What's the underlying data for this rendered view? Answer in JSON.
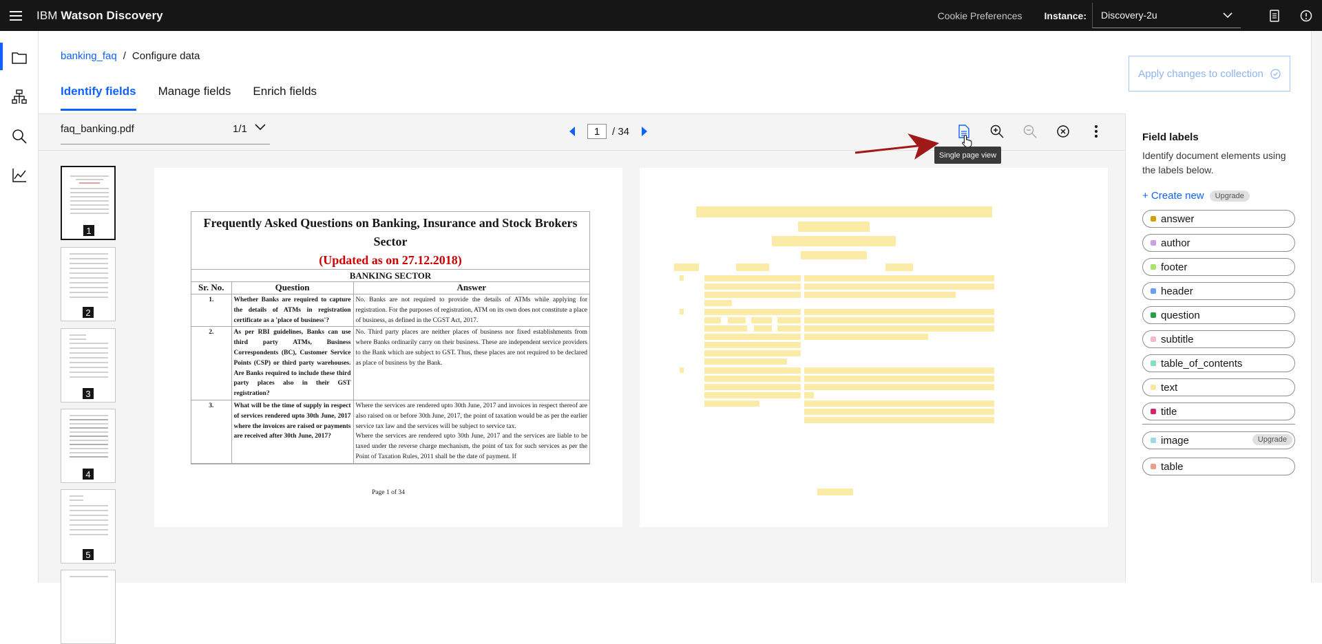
{
  "topbar": {
    "brand_prefix": "IBM",
    "brand_name": "Watson Discovery",
    "cookie": "Cookie Preferences",
    "instance_label": "Instance:",
    "instance_value": "Discovery-2u"
  },
  "breadcrumb": {
    "collection": "banking_faq",
    "separator": "/",
    "current": "Configure data"
  },
  "tabs": [
    "Identify fields",
    "Manage fields",
    "Enrich fields"
  ],
  "apply_button": "Apply changes to collection",
  "toolbar": {
    "file_name": "faq_banking.pdf",
    "file_count": "1/1",
    "page_current": "1",
    "page_total": "/ 34",
    "tooltip": "Single page view"
  },
  "thumbnails": [
    "1",
    "2",
    "3",
    "4",
    "5"
  ],
  "document": {
    "title": "Frequently Asked Questions on Banking, Insurance and Stock Brokers Sector",
    "subtitle": "(Updated as on 27.12.2018)",
    "section": "BANKING SECTOR",
    "headers": [
      "Sr. No.",
      "Question",
      "Answer"
    ],
    "rows": [
      {
        "no": "1.",
        "q": "Whether Banks are required to capture the details of ATMs in registration certificate as a 'place of business'?",
        "a": "No. Banks are not required to provide the details of ATMs while applying for registration. For the purposes of registration, ATM on its own does not constitute a place of business, as defined in the CGST Act, 2017."
      },
      {
        "no": "2.",
        "q": "As per RBI guidelines, Banks can use third party ATMs, Business Correspondents (BC), Customer Service Points (CSP) or third party warehouses. Are Banks required to include these third party places also in their GST registration?",
        "a": "No. Third party places are neither places of business nor fixed establishments from where Banks ordinarily carry on their business. These are independent service providers to the Bank which are subject to GST. Thus, these places are not required to be declared as place of business by the Bank."
      },
      {
        "no": "3.",
        "q": "What will be the time of supply in respect of services rendered upto 30th June, 2017 where the invoices are raised or payments are received after 30th June, 2017?",
        "a": "Where the services are rendered upto 30th June, 2017 and invoices in respect thereof are also raised on or before 30th June, 2017, the point of taxation would be as per the earlier service tax law and the services will be subject to service tax.",
        "a2": "Where the services are rendered upto 30th June, 2017 and the services are liable to be taxed under the reverse charge mechanism, the point of tax for such services as per the Point of Taxation Rules, 2011 shall be the date of payment. If"
      }
    ],
    "page_footer": "Page 1 of 34"
  },
  "panel": {
    "title": "Field labels",
    "description": "Identify document elements using the labels below.",
    "create": "+ Create new",
    "upgrade": "Upgrade",
    "labels": [
      {
        "name": "answer",
        "color": "#d2a106"
      },
      {
        "name": "author",
        "color": "#c9a0e8"
      },
      {
        "name": "footer",
        "color": "#a7e36a"
      },
      {
        "name": "header",
        "color": "#6e9df5"
      },
      {
        "name": "question",
        "color": "#24a148"
      },
      {
        "name": "subtitle",
        "color": "#f5b8d0"
      },
      {
        "name": "table_of_contents",
        "color": "#7ee0c0"
      },
      {
        "name": "text",
        "color": "#fbe7a1"
      },
      {
        "name": "title",
        "color": "#d12771"
      }
    ],
    "special_labels": [
      {
        "name": "image",
        "color": "#9ed9e8",
        "badge": "Upgrade"
      },
      {
        "name": "table",
        "color": "#e8a08a"
      }
    ]
  },
  "colors": {
    "accent": "#0f62fe",
    "topbar": "#161616",
    "highlight": "#fbeba6",
    "arrow": "#a01818"
  }
}
